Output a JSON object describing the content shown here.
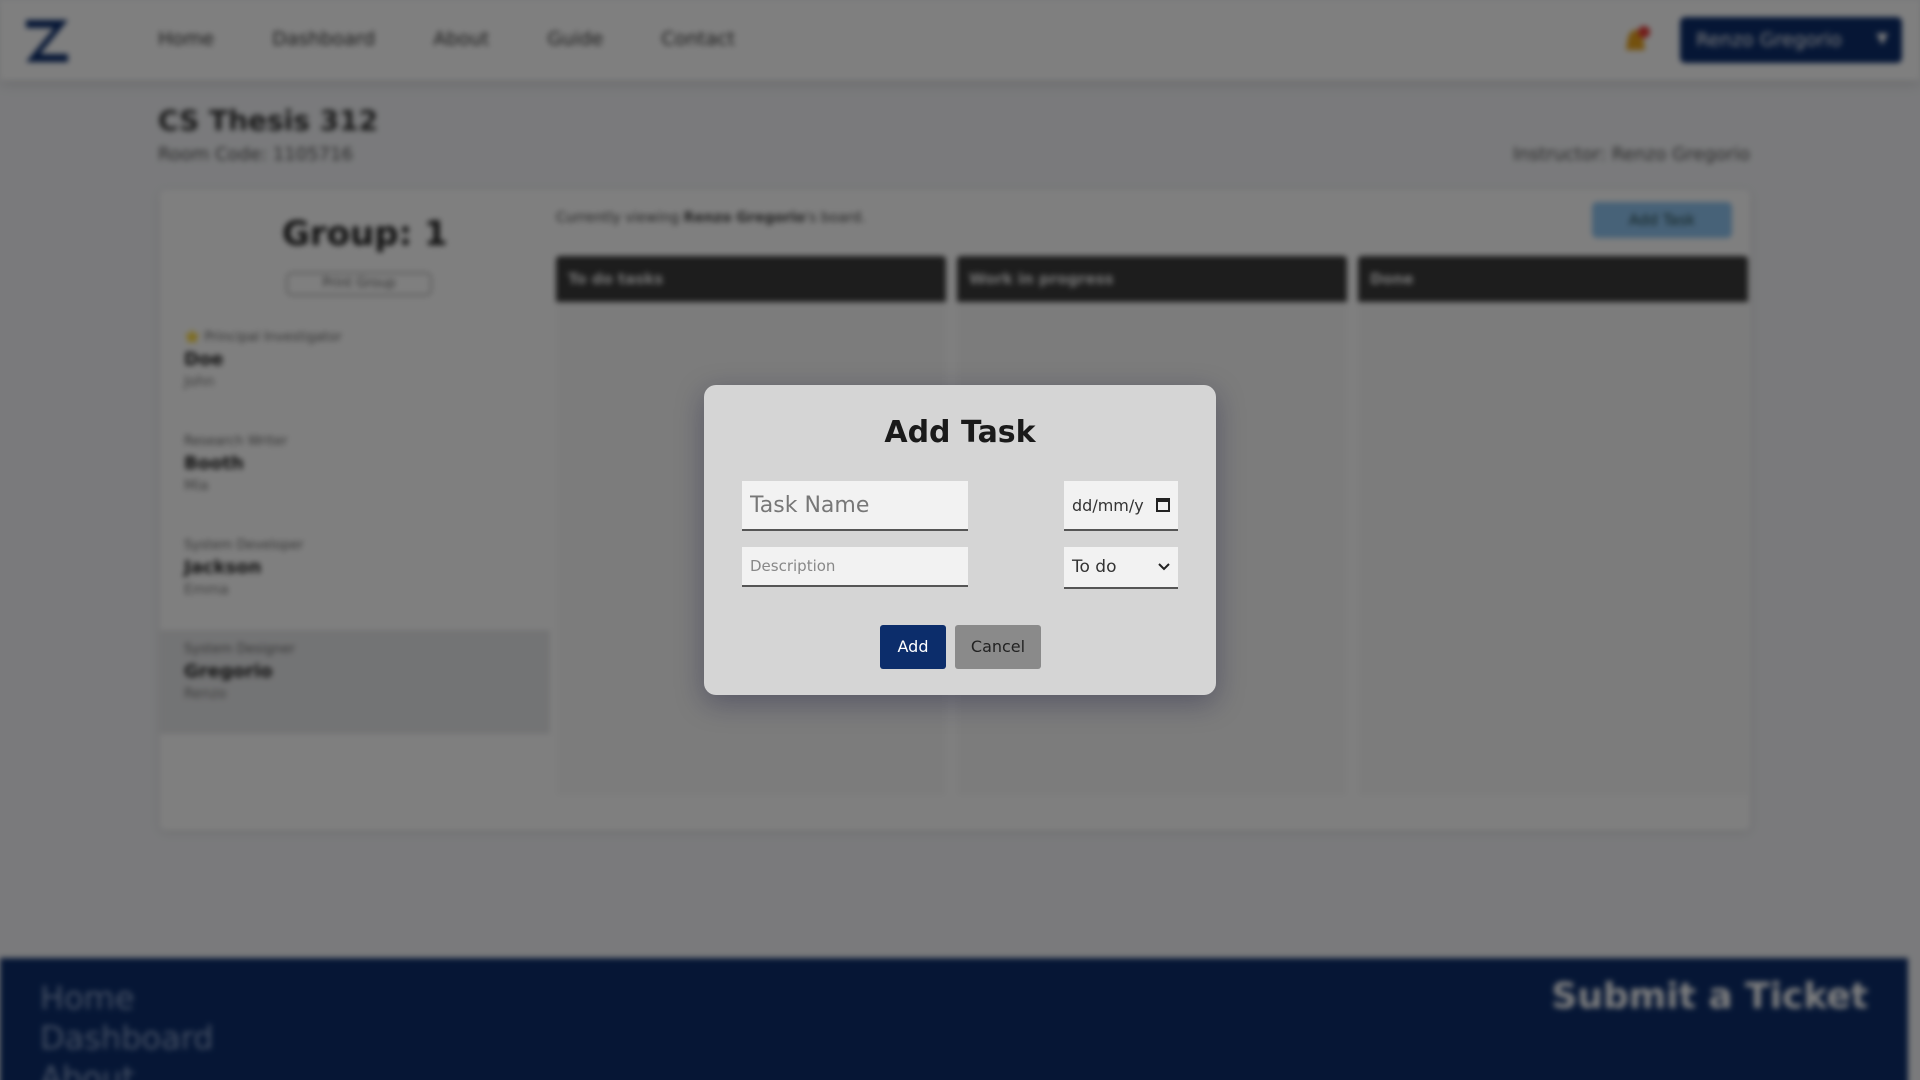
{
  "nav": {
    "items": [
      "Home",
      "Dashboard",
      "About",
      "Guide",
      "Contact"
    ],
    "user": "Renzo Gregorio"
  },
  "course": {
    "title": "CS Thesis 312",
    "room_code": "Room Code: 1105716",
    "instructor": "Instructor: Renzo Gregorio"
  },
  "group": {
    "title": "Group: 1",
    "print_label": "Print Group",
    "members": [
      {
        "role": "⭐ Principal Investigator",
        "last": "Doe",
        "first": "John"
      },
      {
        "role": "Research Writer",
        "last": "Booth",
        "first": "Mia"
      },
      {
        "role": "System Developer",
        "last": "Jackson",
        "first": "Emma"
      },
      {
        "role": "System Designer",
        "last": "Gregorio",
        "first": "Renzo"
      }
    ]
  },
  "board": {
    "viewing_prefix": "Currently viewing ",
    "viewing_name": "Renzo Gregorio",
    "viewing_suffix": "'s board.",
    "add_task_label": "Add Task",
    "columns": [
      "To do tasks",
      "Work in progress",
      "Done"
    ]
  },
  "footer": {
    "links": [
      "Home",
      "Dashboard",
      "About"
    ],
    "ticket": "Submit a Ticket"
  },
  "modal": {
    "title": "Add Task",
    "task_name_placeholder": "Task Name",
    "description_placeholder": "Description",
    "date_placeholder": "dd/mm/y",
    "status_value": "To do",
    "add_label": "Add",
    "cancel_label": "Cancel"
  },
  "colors": {
    "primary": "#0c2d6b",
    "modal_bg": "#d5d5d5",
    "cancel_bg": "#8a8a8a",
    "column_header": "#3a3a3a"
  }
}
